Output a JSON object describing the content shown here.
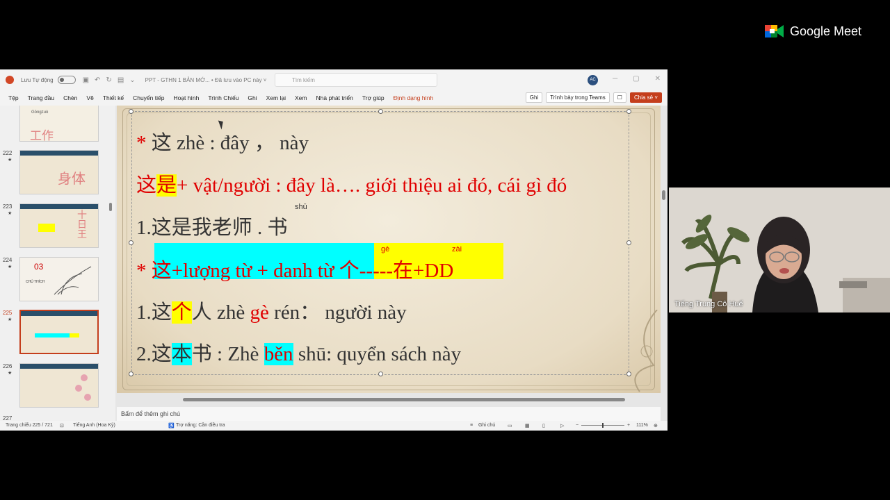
{
  "meet": {
    "brand": "Google Meet",
    "participant_name": "Tiếng Trung Cô Huế"
  },
  "ppt": {
    "autosave_label": "Lưu Tự động",
    "doc_title": "PPT - GTHN 1 BẢN MỚ... • Đã lưu vào PC này ˅",
    "search_placeholder": "Tìm kiếm",
    "avatar_initials": "AC",
    "tabs": [
      "Tệp",
      "Trang đầu",
      "Chèn",
      "Vẽ",
      "Thiết kế",
      "Chuyển tiếp",
      "Hoạt hình",
      "Trình Chiếu",
      "Ghi",
      "Xem lại",
      "Xem",
      "Nhà phát triển",
      "Trợ giúp",
      "Định dạng hình"
    ],
    "buttons": {
      "record": "Ghi",
      "present_teams": "Trình bày trong Teams",
      "share": "Chia sẻ ˅"
    },
    "thumbnails": [
      {
        "num": "",
        "words": "工作"
      },
      {
        "num": "222",
        "words": "身体"
      },
      {
        "num": "223",
        "words": "十日王"
      },
      {
        "num": "224",
        "words": "03"
      },
      {
        "num": "225",
        "words": ""
      },
      {
        "num": "226",
        "words": ""
      },
      {
        "num": "227",
        "words": ""
      }
    ],
    "thumb_texts": {
      "t221_a": "工作",
      "t221_b": "Gōngzuò",
      "t222_a": "身体",
      "t224_a": "03",
      "t224_b": "CHÚ THÍCH"
    },
    "slide": {
      "line1": {
        "star": "*",
        "text": " 这 zhè : đây ， này"
      },
      "line2": {
        "a": "这",
        "b": "是",
        "c": "+  vật/người  : đây là…. giới thiệu ai đó, cái gì đó"
      },
      "line3": {
        "text": "1.这是我老师 . 书",
        "pinyin": "shū"
      },
      "line4": {
        "star": "*",
        "a": " 这+lượng từ + danh từ ",
        "b": "个-----在",
        "c": "+DD",
        "pinyin1": "gè",
        "pinyin2": "zài"
      },
      "line5": {
        "a": "1.这",
        "b": "个",
        "c": "人 zhè ",
        "d": "gè",
        "e": " rén：  người này"
      },
      "line6": {
        "a": "2.这",
        "b": "本",
        "c": "书 : Zhè ",
        "d": "běn",
        "e": " shū: quyển sách này"
      }
    },
    "notes_placeholder": "Bấm để thêm ghi chú",
    "status": {
      "slide_count": "Trang chiếu 225 / 721",
      "language": "Tiếng Anh (Hoa Kỳ)",
      "accessibility": "Trợ năng: Cần điều tra",
      "notes_button": "Ghi chú",
      "zoom": "111%"
    }
  }
}
